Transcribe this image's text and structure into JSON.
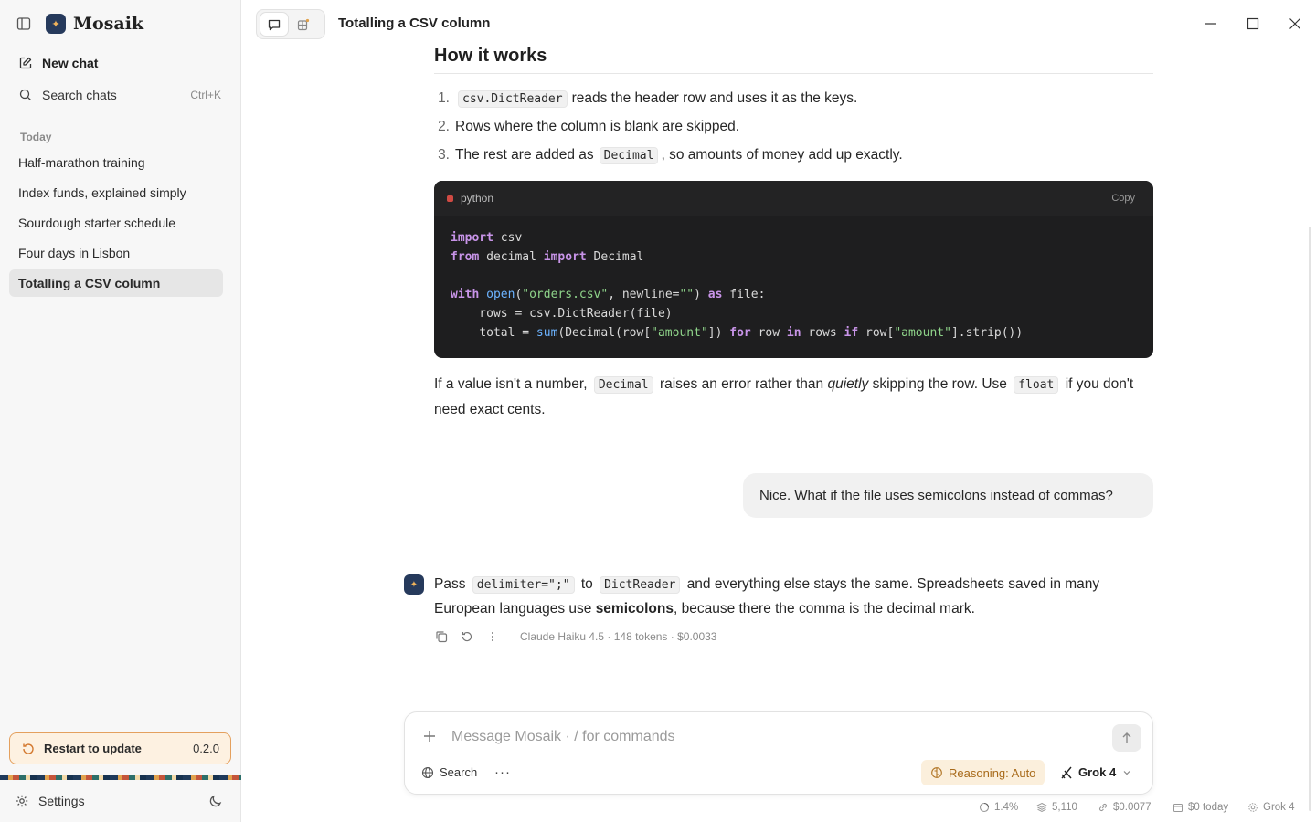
{
  "app": {
    "name": "Mosaik"
  },
  "sidebar": {
    "new_chat": "New chat",
    "search": "Search chats",
    "search_shortcut": "Ctrl+K",
    "group_label": "Today",
    "conversations": [
      "Half-marathon training",
      "Index funds, explained simply",
      "Sourdough starter schedule",
      "Four days in Lisbon",
      "Totalling a CSV column"
    ],
    "active_index": 4,
    "update_label": "Restart to update",
    "update_version": "0.2.0",
    "settings": "Settings"
  },
  "topbar": {
    "title": "Totalling a CSV column"
  },
  "message1": {
    "heading": "How it works",
    "list": [
      {
        "num": "1.",
        "code": "csv.DictReader",
        "text": "reads the header row and uses it as the keys."
      },
      {
        "num": "2.",
        "text": "Rows where the column is blank are skipped."
      },
      {
        "num": "3.",
        "pre": "The rest are added as",
        "code": "Decimal",
        "post": ", so amounts of money add up exactly."
      }
    ],
    "code_lang": "python",
    "code_copy": "Copy",
    "para_a": "If a value isn't a number,",
    "para_code1": "Decimal",
    "para_b": "raises an error rather than",
    "para_em": "quietly",
    "para_c": "skipping the row. Use",
    "para_code2": "float",
    "para_d": "if you don't need exact cents."
  },
  "user_message": "Nice. What if the file uses semicolons instead of commas?",
  "message2": {
    "a": "Pass",
    "code1": "delimiter=\";\"",
    "b": "to",
    "code2": "DictReader",
    "c": "and everything else stays the same. Spreadsheets saved in many European languages use",
    "bold": "semicolons",
    "d": ", because there the comma is the decimal mark.",
    "meta": "Claude Haiku 4.5 · 148 tokens · $0.0033"
  },
  "composer": {
    "placeholder": "Message Mosaik  ·  / for commands",
    "search": "Search",
    "more": "···",
    "reasoning": "Reasoning: Auto",
    "model": "Grok 4"
  },
  "status": {
    "context": "1.4%",
    "tokens": "5,110",
    "cost": "$0.0077",
    "today": "$0 today",
    "model": "Grok 4"
  },
  "colors": {
    "accent": "#e4a05e",
    "logo_bg": "#263a5c",
    "code_bg": "#1e1e1f"
  }
}
